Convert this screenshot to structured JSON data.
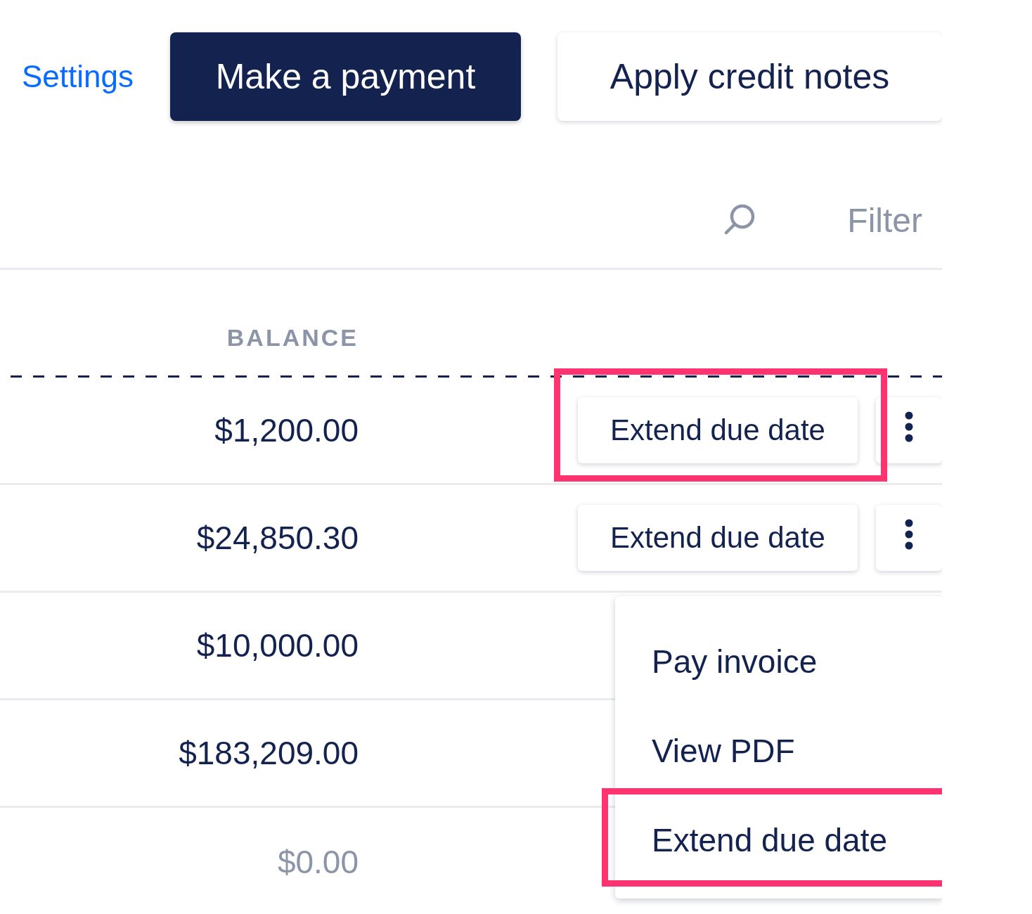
{
  "header": {
    "settings_link": "Settings",
    "primary_button": "Make a payment",
    "secondary_button": "Apply credit notes"
  },
  "toolbar": {
    "filter": "Filter"
  },
  "table": {
    "columns": [
      {
        "label": "BALANCE"
      }
    ],
    "rows": [
      {
        "balance": "$1,200.00",
        "muted": false,
        "action": "Extend due date",
        "highlighted": true
      },
      {
        "balance": "$24,850.30",
        "muted": false,
        "action": "Extend due date",
        "highlighted": false
      },
      {
        "balance": "$10,000.00",
        "muted": false
      },
      {
        "balance": "$183,209.00",
        "muted": false
      },
      {
        "balance": "$0.00",
        "muted": true
      }
    ]
  },
  "menu": {
    "items": [
      {
        "label": "Pay invoice",
        "highlighted": false
      },
      {
        "label": "View PDF",
        "highlighted": false
      },
      {
        "label": "Extend due date",
        "highlighted": true
      }
    ]
  }
}
